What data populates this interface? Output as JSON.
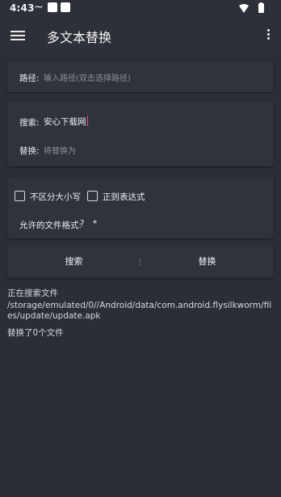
{
  "status_bar": {
    "time": "4:43",
    "icons": [
      "notification-square-icon",
      "notification-square-icon",
      "wifi-icon",
      "battery-icon"
    ]
  },
  "app_bar": {
    "title": "多文本替换",
    "menu_icon": "hamburger-menu-icon",
    "overflow_icon": "more-vertical-icon"
  },
  "path_card": {
    "label": "路径:",
    "placeholder": "输入路径(双击选择路径)"
  },
  "search_card": {
    "search_label": "搜索:",
    "search_value": "安心下载网",
    "replace_label": "替换:",
    "replace_placeholder": "将替换为"
  },
  "options_card": {
    "case_insensitive_label": "不区分大小写",
    "case_insensitive_checked": false,
    "regex_label": "正则表达式",
    "regex_checked": false,
    "formats_label": "允许的文件格式:",
    "formats_help": "?",
    "formats_value": "*"
  },
  "actions": {
    "search_label": "搜索",
    "replace_label": "替换"
  },
  "log": {
    "line1": "正在搜索文件",
    "line2": "/storage/emulated/0//Android/data/com.android.flysilkworm/files/update/update.apk",
    "line3": "替换了0个文件"
  },
  "colors": {
    "background": "#2b2e37",
    "card": "#30333c",
    "caret": "#e84b8a"
  }
}
